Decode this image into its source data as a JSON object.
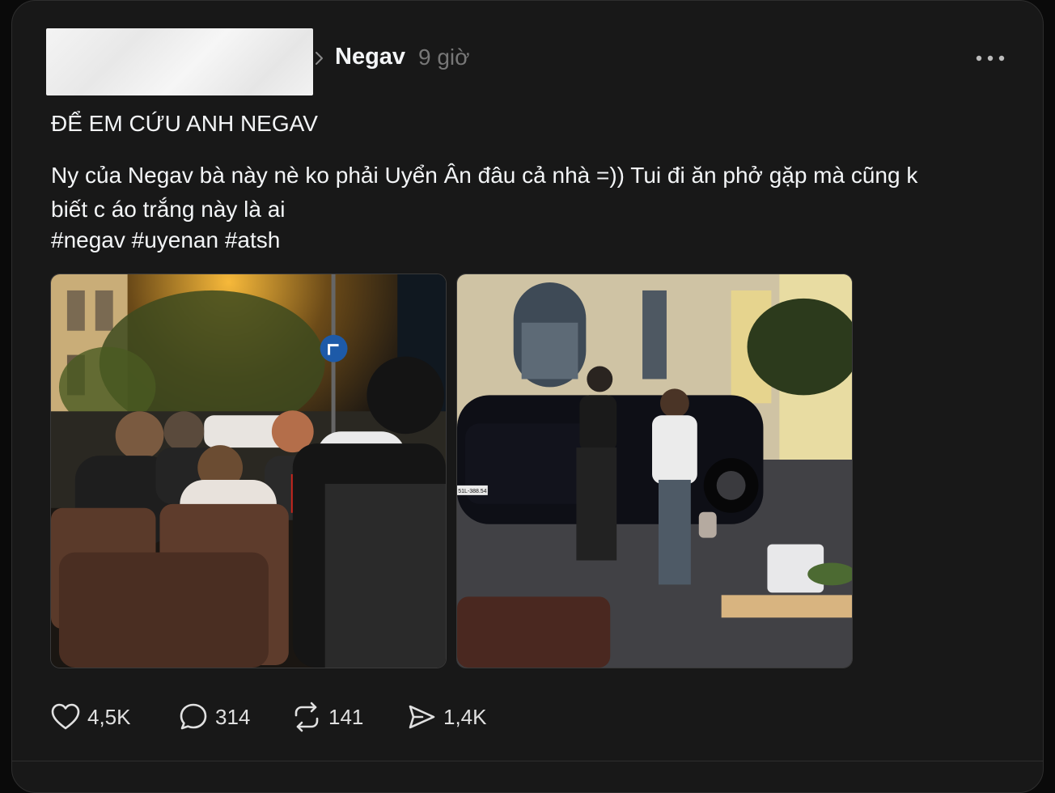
{
  "post": {
    "author": "Negav",
    "time": "9 giờ",
    "title": "ĐỂ EM CỨU ANH NEGAV",
    "body": "Ny của Negav bà này nè ko phải Uyển Ân đâu cả nhà =)) Tui đi ăn phở gặp mà cũng k\nbiết c áo trắng này là ai",
    "hashtags": "#negav #uyenan #atsh"
  },
  "media": {
    "images": [
      {
        "name": "night-street-restaurant-photo"
      },
      {
        "name": "couple-walking-by-car-photo"
      }
    ],
    "plate_text": "51L-388.54"
  },
  "actions": {
    "likes": "4,5K",
    "replies": "314",
    "reposts": "141",
    "shares": "1,4K"
  },
  "icons": {
    "like": "heart-icon",
    "reply": "speech-bubble-icon",
    "repost": "repost-arrows-icon",
    "share": "send-icon",
    "more": "ellipsis-icon",
    "chevron": "chevron-right-icon"
  },
  "colors": {
    "background": "#181818",
    "text": "#f3f5f7",
    "secondary": "#777777"
  }
}
